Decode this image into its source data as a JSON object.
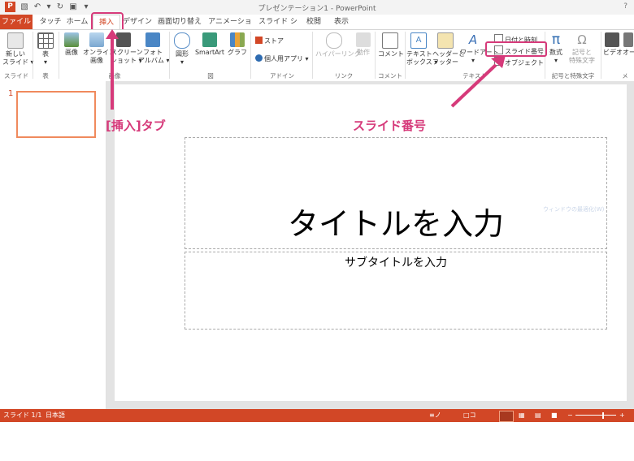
{
  "window": {
    "title": "プレゼンテーション1 - PowerPoint",
    "help": "?",
    "logo": "P"
  },
  "tabs": [
    "ファイル",
    "タッチ",
    "ホーム",
    "挿入",
    "デザイン",
    "画面切り替え",
    "アニメーション",
    "スライド ショー",
    "校閲",
    "表示"
  ],
  "ribbon": {
    "buttons": [
      "新しい\nスライド ▾",
      "表\n▾",
      "画像",
      "オンライン\n画像",
      "スクリーン\nショット ▾",
      "フォト\nアルバム ▾",
      "図形\n▾",
      "SmartArt",
      "グラフ",
      "ハイパーリンク",
      "動作",
      "コメント",
      "テキスト\nボックス ▾",
      "ヘッダーと\nフッター",
      "ワードアート\n▾",
      "数式\n▾",
      "記号と\n特殊文字",
      "ビデオ",
      "オー"
    ],
    "small_items": [
      "ストア",
      "個人用アプリ ▾",
      "日付と時刻",
      "スライド番号",
      "オブジェクト"
    ],
    "groups": [
      "スライド",
      "表",
      "画像",
      "図",
      "アドイン",
      "リンク",
      "コメント",
      "テキスト",
      "記号と特殊文字",
      "メ"
    ]
  },
  "slides_pane": {
    "slide_number": "1"
  },
  "slide": {
    "title_placeholder": "タイトルを入力",
    "subtitle_placeholder": "サブタイトルを入力",
    "faint_text": "ウィンドウの最適化(W)"
  },
  "annotations": {
    "insert_tab": "[挿入]タブ",
    "slide_number": "スライド番号"
  },
  "statusbar": {
    "slide_info": "スライド 1/1",
    "language": "日本語",
    "notes": "ノート",
    "comments": "コメント"
  },
  "colors": {
    "accent": "#d24726",
    "annotation": "#d63a7a"
  }
}
